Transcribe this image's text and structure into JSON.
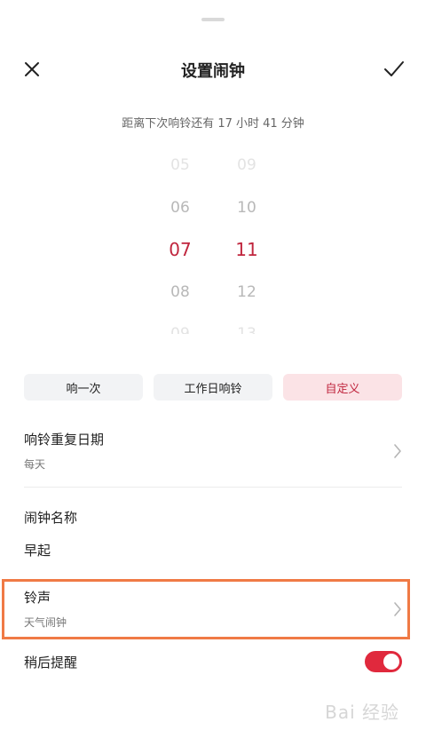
{
  "header": {
    "title": "设置闹钟"
  },
  "countdown": "距离下次响铃还有 17 小时 41 分钟",
  "picker": {
    "hours": [
      "05",
      "06",
      "07",
      "08",
      "09"
    ],
    "minutes": [
      "09",
      "10",
      "11",
      "12",
      "13"
    ],
    "selected_hour": "07",
    "selected_minute": "11"
  },
  "repeat_modes": [
    "响一次",
    "工作日响铃",
    "自定义"
  ],
  "active_mode": "自定义",
  "repeat_days": {
    "label": "响铃重复日期",
    "value": "每天"
  },
  "alarm_name": {
    "label": "闹钟名称",
    "value": "早起"
  },
  "ringtone": {
    "label": "铃声",
    "value": "天气闹钟"
  },
  "snooze": {
    "label": "稍后提醒",
    "enabled": true
  },
  "colors": {
    "accent": "#c0263e",
    "toggle_on": "#e0293d",
    "highlight": "#f07a45"
  },
  "watermark": "Bai 经验"
}
